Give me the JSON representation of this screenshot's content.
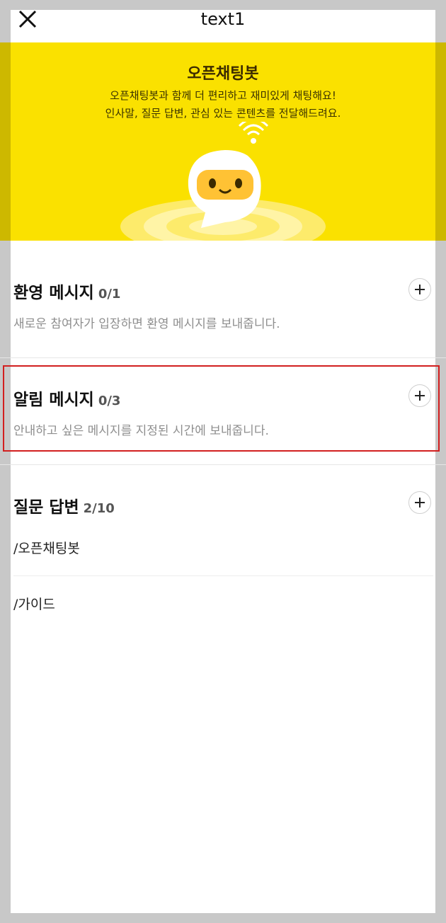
{
  "header": {
    "title": "text1"
  },
  "banner": {
    "title": "오픈채팅봇",
    "desc_line1": "오픈채팅봇과 함께 더 편리하고 재미있게 채팅해요!",
    "desc_line2": "인사말, 질문 답변, 관심 있는 콘텐츠를 전달해드려요."
  },
  "sections": {
    "welcome": {
      "title": "환영 메시지",
      "count": "0/1",
      "desc": "새로운 참여자가 입장하면 환영 메시지를 보내줍니다."
    },
    "notice": {
      "title": "알림 메시지",
      "count": "0/3",
      "desc": "안내하고 싶은 메시지를 지정된 시간에 보내줍니다."
    },
    "qa": {
      "title": "질문 답변",
      "count": "2/10",
      "items": [
        "/오픈채팅봇",
        "/가이드"
      ]
    }
  },
  "colors": {
    "banner": "#fae100",
    "highlight": "#d21f1f"
  },
  "icons": {
    "close": "close-icon",
    "add": "plus-icon",
    "bot": "chatbot-mascot"
  }
}
